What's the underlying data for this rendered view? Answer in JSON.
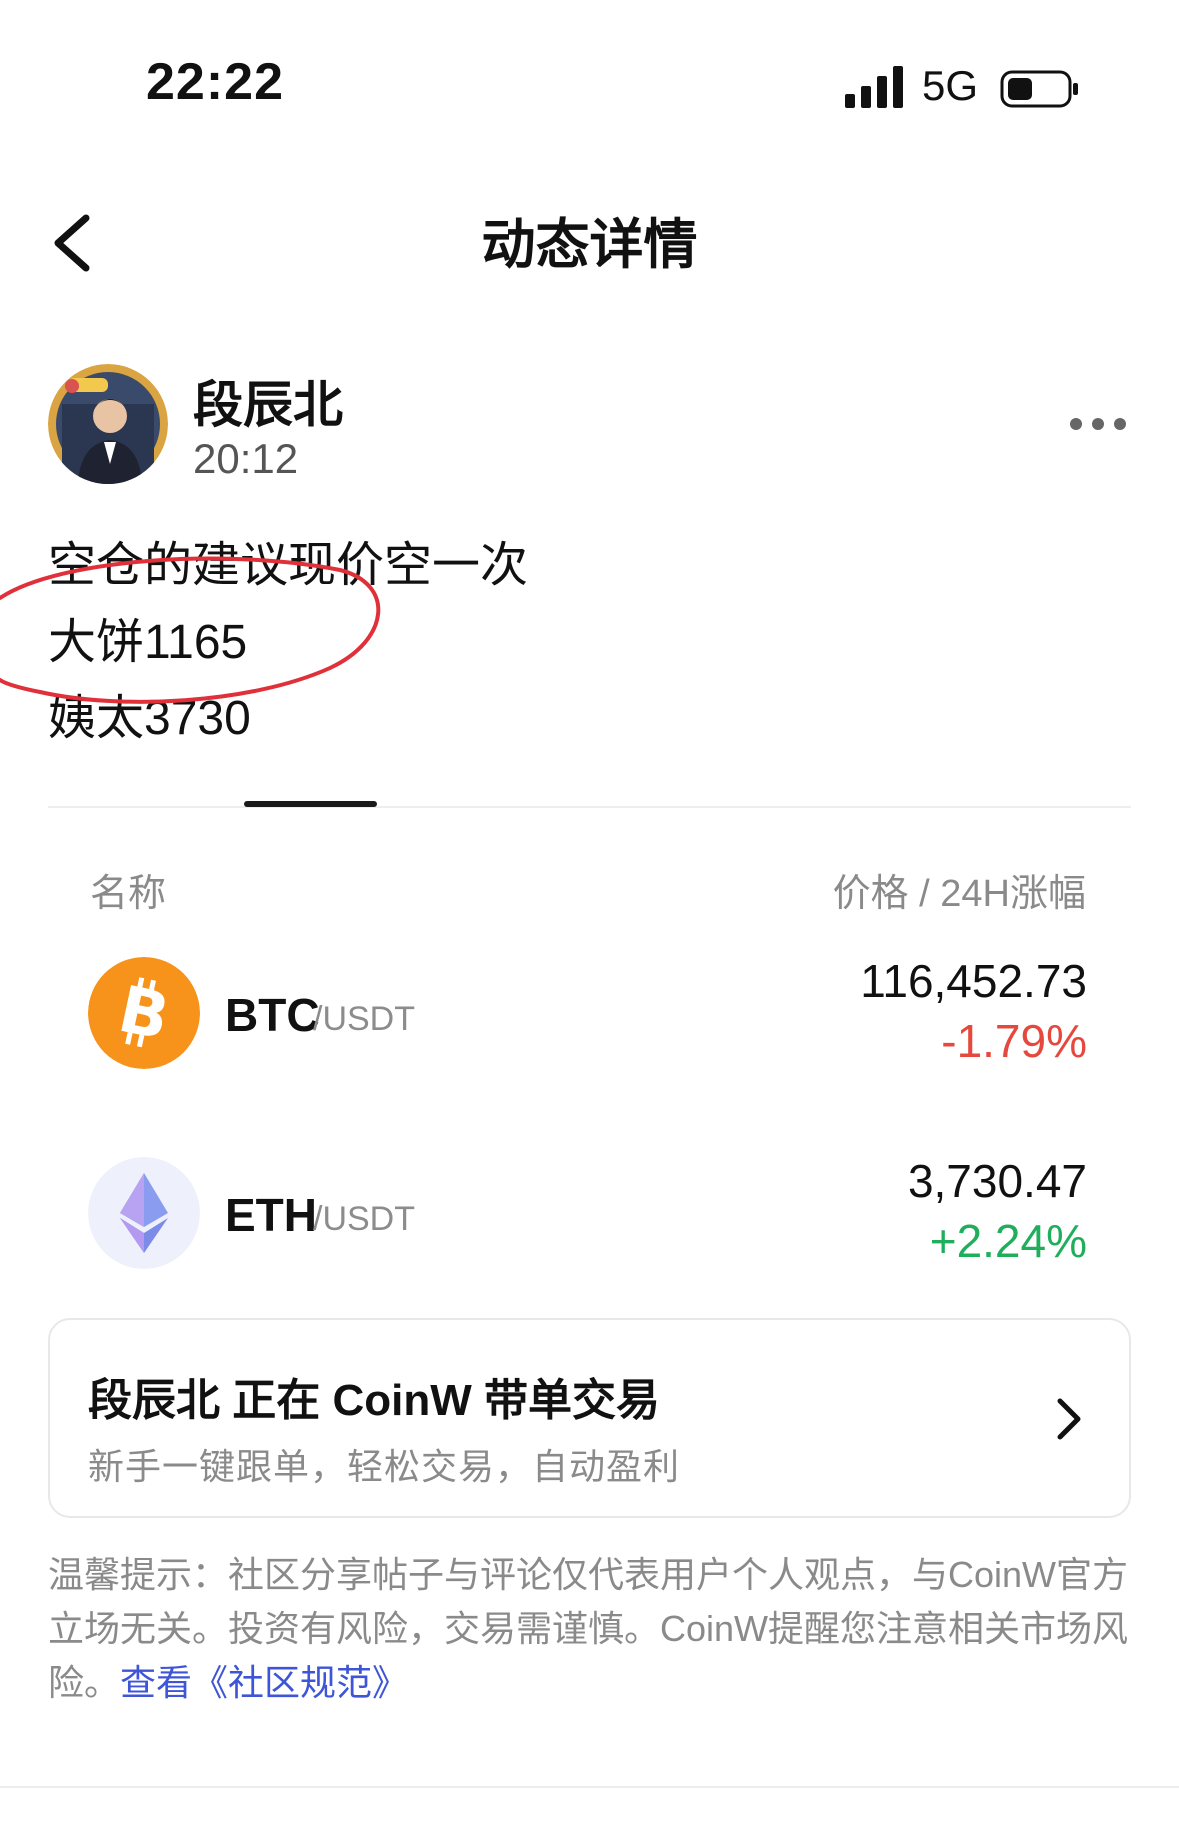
{
  "status_bar": {
    "time": "22:22",
    "network": "5G"
  },
  "nav": {
    "title": "动态详情"
  },
  "post": {
    "author": "段辰北",
    "time": "20:12",
    "lines": [
      "空仓的建议现价空一次",
      "大饼1165",
      "姨太3730"
    ]
  },
  "market": {
    "header_name": "名称",
    "header_price": "价格 / 24H涨幅",
    "coins": [
      {
        "symbol": "BTC",
        "quote": "/USDT",
        "price": "116,452.73",
        "change": "-1.79%",
        "trend": "down",
        "icon": "bitcoin-icon",
        "color": "#f7931a"
      },
      {
        "symbol": "ETH",
        "quote": "/USDT",
        "price": "3,730.47",
        "change": "+2.24%",
        "trend": "up",
        "icon": "ethereum-icon",
        "color": "#627eea"
      }
    ]
  },
  "copy_trade_card": {
    "title": "段辰北 正在 CoinW 带单交易",
    "subtitle": "新手一键跟单，轻松交易，自动盈利"
  },
  "disclaimer": {
    "text": "温馨提示：社区分享帖子与评论仅代表用户个人观点，与CoinW官方立场无关。投资有风险，交易需谨慎。CoinW提醒您注意相关市场风险。",
    "link_prefix": "查看",
    "link_text": "《社区规范》"
  },
  "colors": {
    "negative": "#e5483d",
    "positive": "#1fae5c",
    "link": "#3d55d6",
    "annotation": "#e0303a"
  }
}
